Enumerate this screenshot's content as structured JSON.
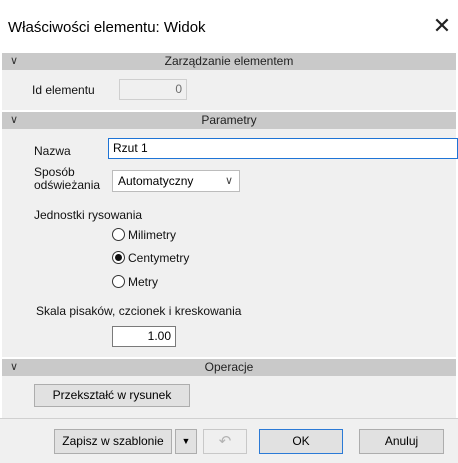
{
  "window": {
    "title": "Właściwości elementu: Widok",
    "close_glyph": "✕"
  },
  "sections": {
    "management": {
      "title": "Zarządzanie elementem",
      "chevron": "∨"
    },
    "parameters": {
      "title": "Parametry",
      "chevron": "∨"
    },
    "operations": {
      "title": "Operacje",
      "chevron": "∨"
    }
  },
  "management": {
    "id_label": "Id elementu",
    "id_value": "0"
  },
  "parameters": {
    "name_label": "Nazwa",
    "name_value": "Rzut 1",
    "refresh_label_line1": "Sposób",
    "refresh_label_line2": "odświeżania",
    "refresh_value": "Automatyczny",
    "refresh_arrow": "∨",
    "units_label": "Jednostki rysowania",
    "units": [
      {
        "label": "Milimetry",
        "selected": false
      },
      {
        "label": "Centymetry",
        "selected": true
      },
      {
        "label": "Metry",
        "selected": false
      }
    ],
    "scale_label": "Skala pisaków, czcionek i kreskowania",
    "scale_value": "1.00"
  },
  "operations": {
    "convert_button": "Przekształć w rysunek"
  },
  "footer": {
    "save_template": "Zapisz w szablonie",
    "dropdown_glyph": "▼",
    "undo_glyph": "↶",
    "ok": "OK",
    "cancel": "Anuluj"
  }
}
